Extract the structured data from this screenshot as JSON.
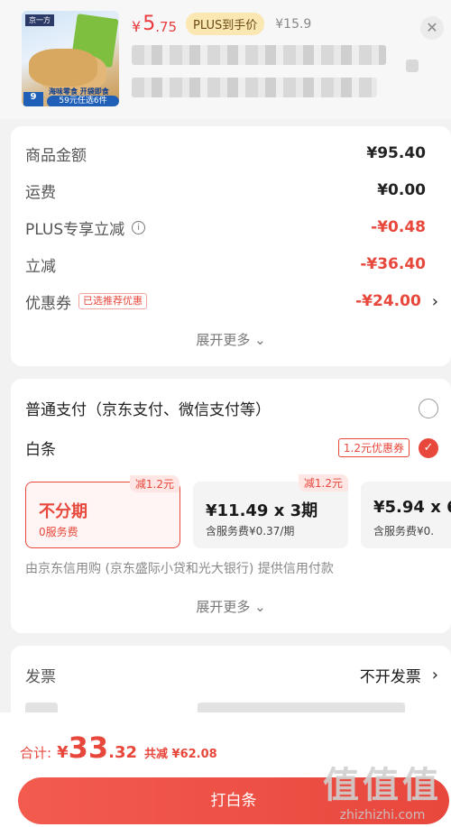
{
  "product": {
    "price_symbol": "¥",
    "price_integer": "5",
    "price_decimal": ".75",
    "plus_badge": "PLUS到手价",
    "original_price": "¥15.9",
    "close_icon": "close-icon",
    "thumb": {
      "brand": "京一方",
      "promo": "海味零食 开袋即食",
      "deal": "59元任选6件",
      "corner": "9"
    }
  },
  "summary": {
    "rows": [
      {
        "label": "商品金额",
        "value": "¥95.40"
      },
      {
        "label": "运费",
        "value": "¥0.00"
      },
      {
        "label": "PLUS专享立减",
        "value": "-¥0.48"
      },
      {
        "label": "立减",
        "value": "-¥36.40"
      },
      {
        "label": "优惠券",
        "value": "-¥24.00",
        "tag": "已选推荐优惠"
      }
    ],
    "more": "展开更多 ⌄"
  },
  "payment": {
    "normal_label": "普通支付（京东支付、微信支付等）",
    "baitiao_label": "白条",
    "baitiao_coupon": "1.2元优惠券",
    "plans": [
      {
        "title": "不分期",
        "sub": "0服务费",
        "cut": "减1.2元"
      },
      {
        "title": "¥11.49 x 3期",
        "sub": "含服务费¥0.37/期",
        "cut": "减1.2元"
      },
      {
        "title": "¥5.94 x 6",
        "sub": "含服务费¥0."
      }
    ],
    "credit_note": "由京东信用购 (京东盛际小贷和光大银行) 提供信用付款",
    "more": "展开更多 ⌄"
  },
  "invoice": {
    "label": "发票",
    "value": "不开发票"
  },
  "bottom": {
    "total_label": "合计:",
    "total_symbol": "¥",
    "total_integer": "33",
    "total_decimal": ".32",
    "saved": "共减 ¥62.08",
    "pay_button": "打白条"
  },
  "watermark": {
    "big": "值值值",
    "site": "zhizhizhi.com"
  },
  "colors": {
    "accent": "#e8473c",
    "plus_badge_bg": "#fbe7b2"
  }
}
